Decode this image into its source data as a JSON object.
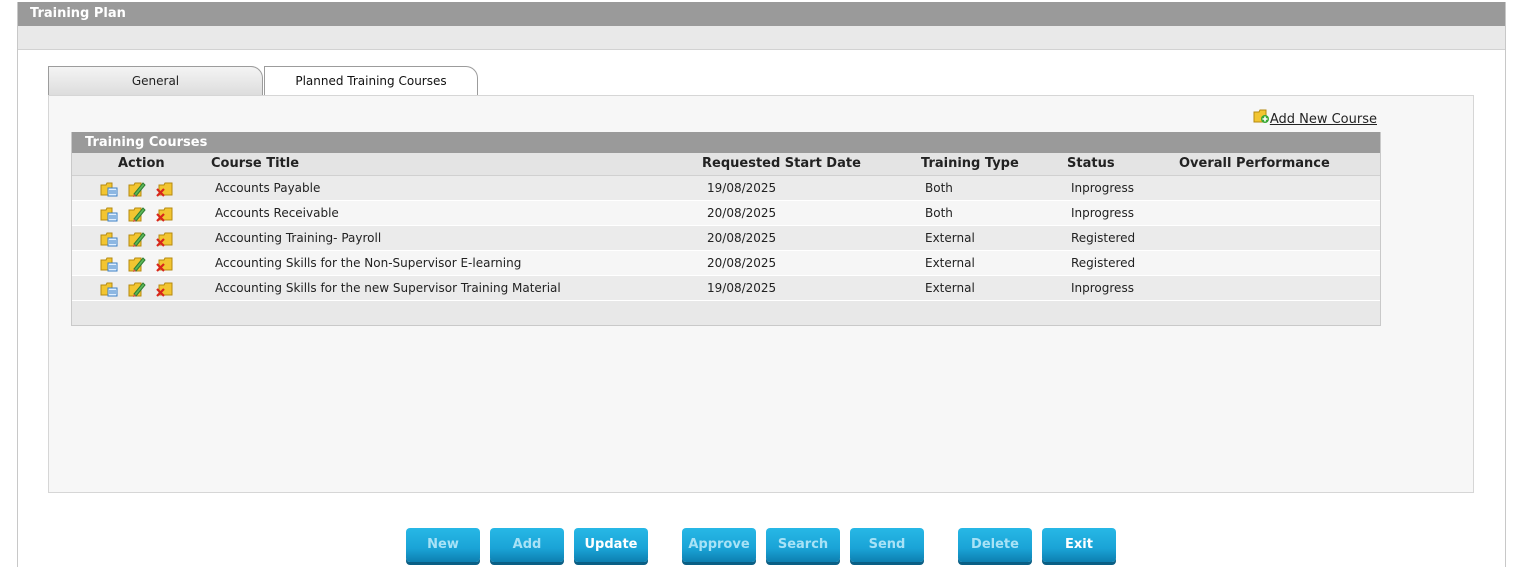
{
  "window": {
    "title": "Training Plan"
  },
  "tabs": [
    {
      "label": "General",
      "active": false
    },
    {
      "label": "Planned Training Courses",
      "active": true
    }
  ],
  "add_course_link": "Add New Course",
  "grid": {
    "caption": "Training Courses",
    "columns": [
      "Action",
      "Course Title",
      "Requested Start Date",
      "Training Type",
      "Status",
      "Overall Performance"
    ],
    "rows": [
      {
        "title": "Accounts Payable",
        "date": "19/08/2025",
        "type": "Both",
        "status": "Inprogress",
        "performance": ""
      },
      {
        "title": "Accounts Receivable",
        "date": "20/08/2025",
        "type": "Both",
        "status": "Inprogress",
        "performance": ""
      },
      {
        "title": "Accounting Training- Payroll",
        "date": "20/08/2025",
        "type": "External",
        "status": "Registered",
        "performance": ""
      },
      {
        "title": "Accounting Skills for the Non-Supervisor E-learning",
        "date": "20/08/2025",
        "type": "External",
        "status": "Registered",
        "performance": ""
      },
      {
        "title": "Accounting Skills for the new Supervisor Training Material",
        "date": "19/08/2025",
        "type": "External",
        "status": "Inprogress",
        "performance": ""
      }
    ],
    "row_action_icons": [
      "view-icon",
      "edit-icon",
      "delete-icon"
    ]
  },
  "buttons": [
    {
      "label": "New",
      "enabled": false
    },
    {
      "label": "Add",
      "enabled": false
    },
    {
      "label": "Update",
      "enabled": true
    },
    {
      "label": "Approve",
      "enabled": false
    },
    {
      "label": "Search",
      "enabled": false
    },
    {
      "label": "Send",
      "enabled": false
    },
    {
      "label": "Delete",
      "enabled": false
    },
    {
      "label": "Exit",
      "enabled": true
    }
  ],
  "colors": {
    "header_gray": "#9a9a9a",
    "button_blue": "#1aa3d6"
  }
}
